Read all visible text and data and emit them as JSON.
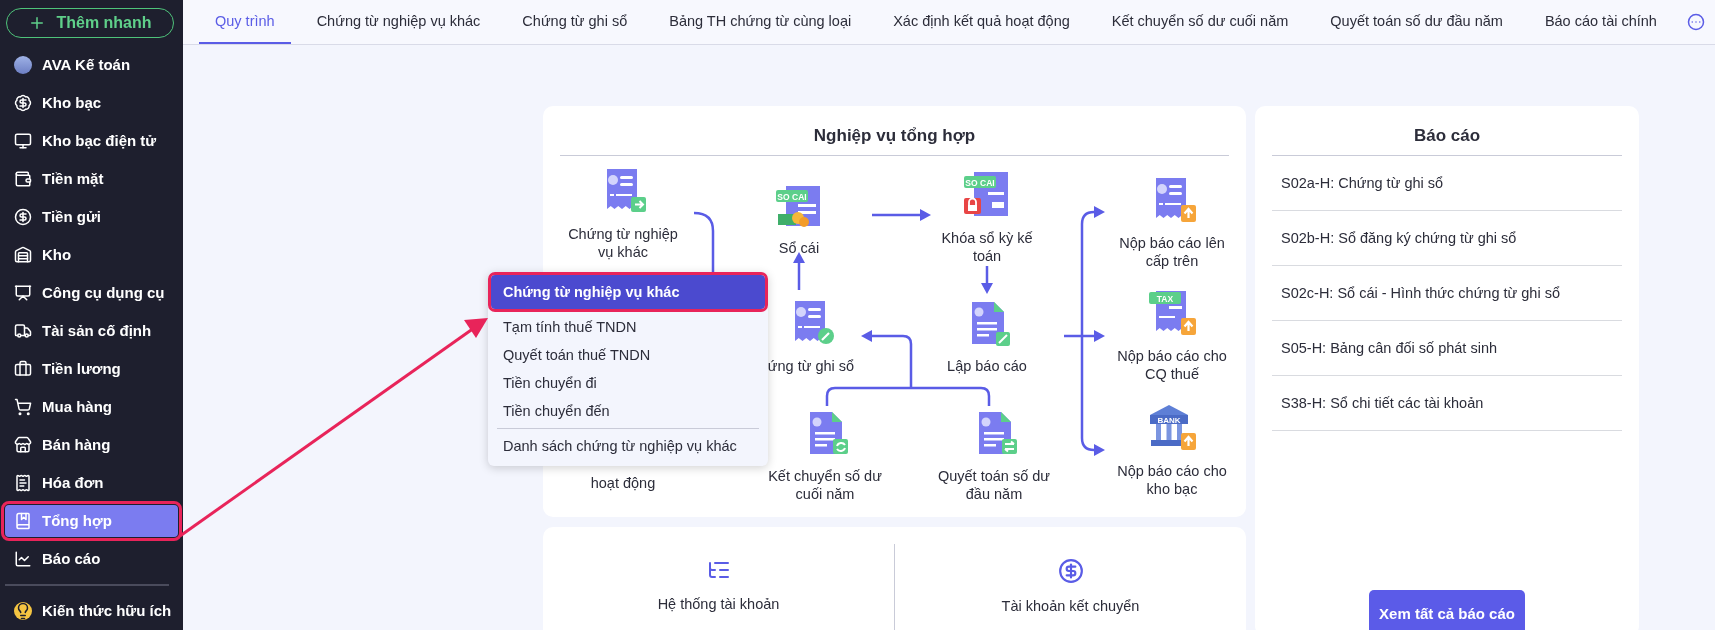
{
  "sidebar": {
    "quick_add": "Thêm nhanh",
    "items": [
      {
        "kind": "avatar",
        "label": "AVA Kế toán",
        "selected": false,
        "annotated": false
      },
      {
        "kind": "treasury",
        "label": "Kho bạc",
        "selected": false,
        "annotated": false
      },
      {
        "kind": "etreasury",
        "label": "Kho bạc điện tử",
        "selected": false,
        "annotated": false
      },
      {
        "kind": "cash",
        "label": "Tiền mặt",
        "selected": false,
        "annotated": false
      },
      {
        "kind": "deposit",
        "label": "Tiền gửi",
        "selected": false,
        "annotated": false
      },
      {
        "kind": "warehouse",
        "label": "Kho",
        "selected": false,
        "annotated": false
      },
      {
        "kind": "tools",
        "label": "Công cụ dụng cụ",
        "selected": false,
        "annotated": false
      },
      {
        "kind": "assets",
        "label": "Tài sản cố định",
        "selected": false,
        "annotated": false
      },
      {
        "kind": "payroll",
        "label": "Tiền lương",
        "selected": false,
        "annotated": false
      },
      {
        "kind": "purchase",
        "label": "Mua hàng",
        "selected": false,
        "annotated": false
      },
      {
        "kind": "sales",
        "label": "Bán hàng",
        "selected": false,
        "annotated": false
      },
      {
        "kind": "invoice",
        "label": "Hóa đơn",
        "selected": false,
        "annotated": false
      },
      {
        "kind": "summary",
        "label": "Tổng hợp",
        "selected": true,
        "annotated": true
      },
      {
        "kind": "report",
        "label": "Báo cáo",
        "selected": false,
        "annotated": false
      }
    ],
    "footer_item": {
      "kind": "knowledge",
      "label": "Kiến thức hữu ích"
    }
  },
  "tabs": [
    {
      "label": "Quy trình",
      "selected": true
    },
    {
      "label": "Chứng từ nghiệp vụ khác",
      "selected": false
    },
    {
      "label": "Chứng từ ghi sổ",
      "selected": false
    },
    {
      "label": "Bảng TH chứng từ cùng loại",
      "selected": false
    },
    {
      "label": "Xác định kết quả hoạt động",
      "selected": false
    },
    {
      "label": "Kết chuyển số dư cuối năm",
      "selected": false
    },
    {
      "label": "Quyết toán số dư đầu năm",
      "selected": false
    },
    {
      "label": "Báo cáo tài chính",
      "selected": false
    }
  ],
  "process": {
    "title": "Nghiệp vụ tổng hợp",
    "nodes": [
      {
        "kind": "receipt-forward",
        "label": "Chứng từ nghiệp vụ khác"
      },
      {
        "kind": "ledger",
        "badge": "SO CAI",
        "label": "Sổ cái"
      },
      {
        "kind": "ledger-lock",
        "badge": "SO CAI",
        "label": "Khóa sổ kỳ kế toán"
      },
      {
        "kind": "receipt-upload",
        "label": "Nộp báo cáo lên cấp trên"
      },
      {
        "kind": "receipt-edit",
        "label": "ứng từ ghi sổ"
      },
      {
        "kind": "doc-edit",
        "label": "Lập báo cáo"
      },
      {
        "kind": "tax-upload",
        "badge": "TAX",
        "label": "Nộp báo cáo cho CQ thuế"
      },
      {
        "kind": "covered",
        "label": "hoạt động"
      },
      {
        "kind": "doc-sync",
        "label": "Kết chuyển số dư cuối năm"
      },
      {
        "kind": "doc-swap",
        "label": "Quyết toán số dư đầu năm"
      },
      {
        "kind": "bank-upload",
        "badge": "BANK",
        "label": "Nộp báo cáo cho kho bạc"
      }
    ]
  },
  "shortcuts": [
    {
      "kind": "tree",
      "label": "Hệ thống tài khoản"
    },
    {
      "kind": "dollar",
      "label": "Tài khoản kết chuyển"
    }
  ],
  "reports": {
    "title": "Báo cáo",
    "items": [
      "S02a-H: Chứng từ ghi sổ",
      "S02b-H: Sổ đăng ký chứng từ ghi sổ",
      "S02c-H: Sổ cái - Hình thức chứng từ ghi sổ",
      "S05-H: Bảng cân đối số phát sinh",
      "S38-H: Sổ chi tiết các tài khoản"
    ],
    "button": "Xem tất cả báo cáo"
  },
  "menu": {
    "groups": [
      [
        {
          "label": "Chứng từ nghiệp vụ khác",
          "selected": true,
          "annotated": true
        },
        {
          "label": "Tạm tính thuế TNDN",
          "selected": false,
          "annotated": false
        },
        {
          "label": "Quyết toán thuế TNDN",
          "selected": false,
          "annotated": false
        },
        {
          "label": "Tiền chuyển đi",
          "selected": false,
          "annotated": false
        },
        {
          "label": "Tiền chuyển đến",
          "selected": false,
          "annotated": false
        }
      ],
      [
        {
          "label": "Danh sách chứng từ nghiệp vụ khác",
          "selected": false,
          "annotated": false
        }
      ]
    ]
  }
}
